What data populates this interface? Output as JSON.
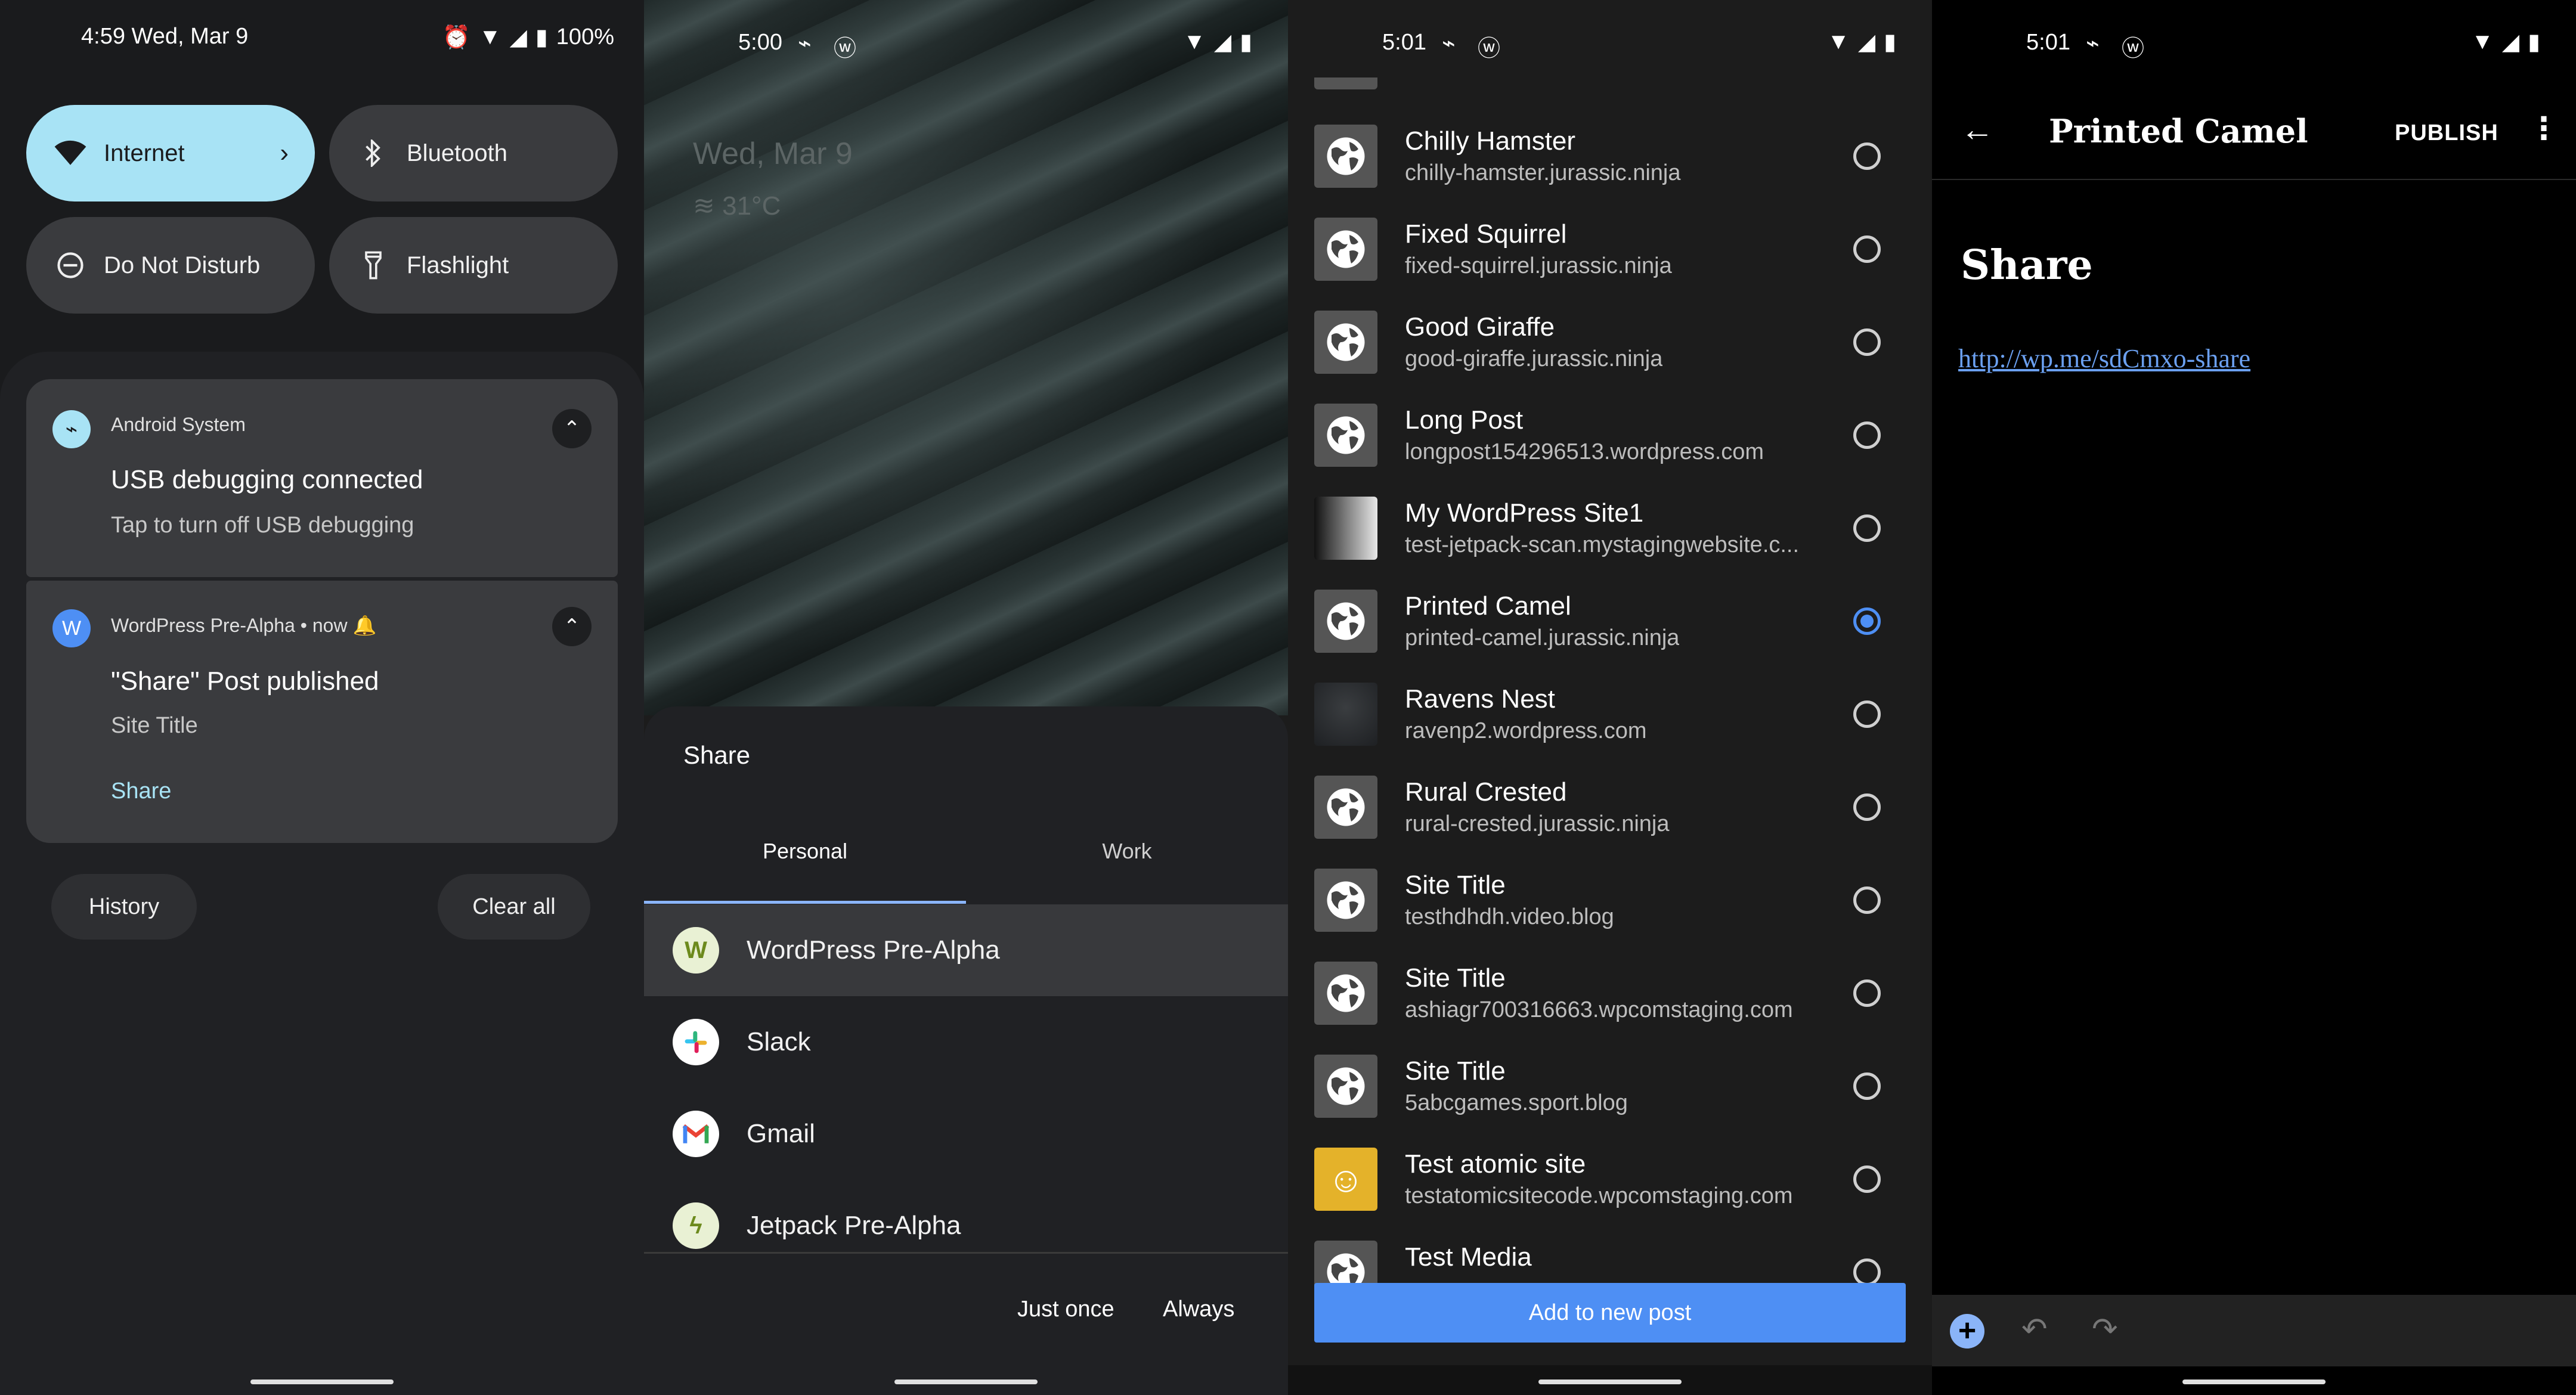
{
  "screen1": {
    "status": {
      "time": "4:59 Wed, Mar 9",
      "battery": "100%"
    },
    "tiles": [
      {
        "label": "Internet",
        "icon": "wifi-icon",
        "active": true
      },
      {
        "label": "Bluetooth",
        "icon": "bluetooth-icon",
        "active": false
      },
      {
        "label": "Do Not Disturb",
        "icon": "do-not-disturb-icon",
        "active": false
      },
      {
        "label": "Flashlight",
        "icon": "flashlight-icon",
        "active": false
      }
    ],
    "notif1": {
      "app": "Android System",
      "title": "USB debugging connected",
      "body": "Tap to turn off USB debugging"
    },
    "notif2": {
      "app": "WordPress Pre-Alpha",
      "time": "now",
      "title": "\"Share\" Post published",
      "body": "Site Title",
      "action": "Share"
    },
    "history_label": "History",
    "clear_all_label": "Clear all"
  },
  "screen2": {
    "status": {
      "time": "5:00"
    },
    "widget": {
      "date": "Wed, Mar 9",
      "weather": "31°C"
    },
    "sheet_title": "Share",
    "tabs": [
      "Personal",
      "Work"
    ],
    "apps": [
      "WordPress Pre-Alpha",
      "Slack",
      "Gmail",
      "Jetpack Pre-Alpha"
    ],
    "just_once": "Just once",
    "always": "Always"
  },
  "screen3": {
    "status": {
      "time": "5:01"
    },
    "sites": [
      {
        "name": "Chilly Hamster",
        "url": "chilly-hamster.jurassic.ninja"
      },
      {
        "name": "Fixed Squirrel",
        "url": "fixed-squirrel.jurassic.ninja"
      },
      {
        "name": "Good Giraffe",
        "url": "good-giraffe.jurassic.ninja"
      },
      {
        "name": "Long Post",
        "url": "longpost154296513.wordpress.com"
      },
      {
        "name": "My WordPress Site1",
        "url": "test-jetpack-scan.mystagingwebsite.c..."
      },
      {
        "name": "Printed Camel",
        "url": "printed-camel.jurassic.ninja"
      },
      {
        "name": "Ravens Nest",
        "url": "ravenp2.wordpress.com"
      },
      {
        "name": "Rural Crested",
        "url": "rural-crested.jurassic.ninja"
      },
      {
        "name": "Site Title",
        "url": "testhdhdh.video.blog"
      },
      {
        "name": "Site Title",
        "url": "ashiagr700316663.wpcomstaging.com"
      },
      {
        "name": "Site Title",
        "url": "5abcgames.sport.blog"
      },
      {
        "name": "Test atomic site",
        "url": "testatomicsitecode.wpcomstaging.com"
      },
      {
        "name": "Test Media",
        "url": ""
      }
    ],
    "selected_site": "Printed Camel",
    "add_button": "Add to new post"
  },
  "screen4": {
    "status": {
      "time": "5:01"
    },
    "title": "Printed Camel",
    "publish": "PUBLISH",
    "post_title": "Share",
    "post_link": "http://wp.me/sdCmxo-share"
  },
  "colors": {
    "accent": "#4e8ff4",
    "tile_active": "#a8e3f5",
    "link": "#6ba0f0"
  }
}
